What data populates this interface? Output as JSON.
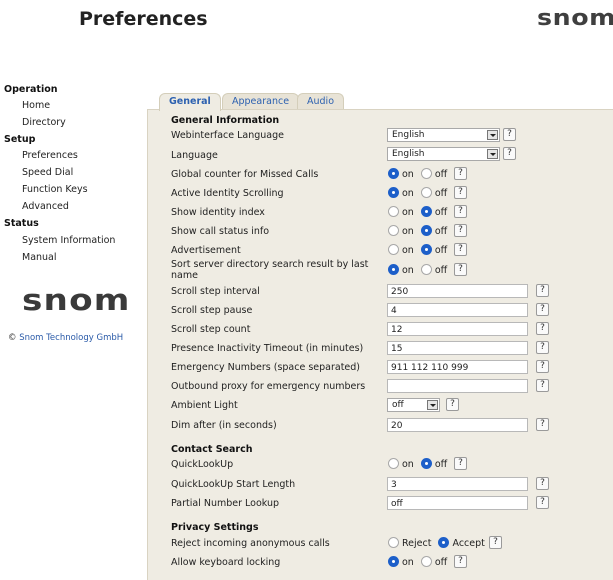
{
  "header": {
    "title": "Preferences",
    "logo_text": "snom"
  },
  "sidebar": {
    "sections": [
      {
        "title": "Operation",
        "items": [
          "Home",
          "Directory"
        ]
      },
      {
        "title": "Setup",
        "items": [
          "Preferences",
          "Speed Dial",
          "Function Keys",
          "Advanced"
        ]
      },
      {
        "title": "Status",
        "items": [
          "System Information",
          "Manual"
        ]
      }
    ],
    "logo_text": "snom",
    "copyright_symbol": "©",
    "copyright_text": "Snom Technology GmbH"
  },
  "tabs": {
    "general": "General",
    "appearance": "Appearance",
    "audio": "Audio",
    "active": "General"
  },
  "general_information": {
    "title": "General Information",
    "webinterface_language": {
      "label": "Webinterface Language",
      "value": "English"
    },
    "language": {
      "label": "Language",
      "value": "English"
    },
    "global_counter": {
      "label": "Global counter for Missed Calls",
      "value": "on"
    },
    "active_identity_scrolling": {
      "label": "Active Identity Scrolling",
      "value": "on"
    },
    "show_identity_index": {
      "label": "Show identity index",
      "value": "off"
    },
    "show_call_status_info": {
      "label": "Show call status info",
      "value": "off"
    },
    "advertisement": {
      "label": "Advertisement",
      "value": "off"
    },
    "sort_server_directory": {
      "label": "Sort server directory search result by last name",
      "value": "on"
    },
    "scroll_step_interval": {
      "label": "Scroll step interval",
      "value": "250"
    },
    "scroll_step_pause": {
      "label": "Scroll step pause",
      "value": "4"
    },
    "scroll_step_count": {
      "label": "Scroll step count",
      "value": "12"
    },
    "presence_inactivity_timeout": {
      "label": "Presence Inactivity Timeout (in minutes)",
      "value": "15"
    },
    "emergency_numbers": {
      "label": "Emergency Numbers (space separated)",
      "value": "911 112 110 999"
    },
    "outbound_proxy_emergency": {
      "label": "Outbound proxy for emergency numbers",
      "value": ""
    },
    "ambient_light": {
      "label": "Ambient Light",
      "value": "off"
    },
    "dim_after": {
      "label": "Dim after (in seconds)",
      "value": "20"
    }
  },
  "contact_search": {
    "title": "Contact Search",
    "quicklookup": {
      "label": "QuickLookUp",
      "value": "off"
    },
    "quicklookup_start_length": {
      "label": "QuickLookUp Start Length",
      "value": "3"
    },
    "partial_number_lookup": {
      "label": "Partial Number Lookup",
      "value": "off"
    }
  },
  "privacy_settings": {
    "title": "Privacy Settings",
    "reject_anonymous": {
      "label": "Reject incoming anonymous calls",
      "value": "Accept"
    },
    "allow_keyboard_locking": {
      "label": "Allow keyboard locking",
      "value": "on"
    }
  },
  "radio_labels": {
    "on": "on",
    "off": "off",
    "reject": "Reject",
    "accept": "Accept"
  },
  "help_glyph": "?",
  "colors": {
    "accent": "#1d5fc9",
    "link": "#2d61b0",
    "panel": "#efece3"
  }
}
